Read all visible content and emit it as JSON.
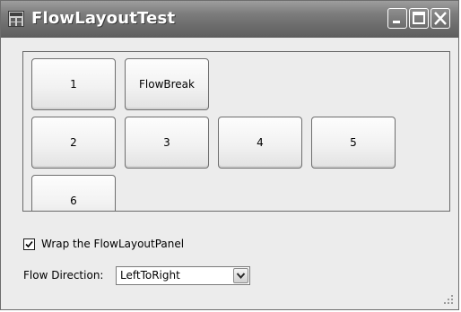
{
  "window": {
    "title": "FlowLayoutTest",
    "controls": [
      "minimize-icon",
      "maximize-icon",
      "close-icon"
    ]
  },
  "flow_panel": {
    "buttons": [
      {
        "id": "b1",
        "label": "1"
      },
      {
        "id": "bfb",
        "label": "FlowBreak"
      },
      {
        "id": "b2",
        "label": "2"
      },
      {
        "id": "b3",
        "label": "3"
      },
      {
        "id": "b4",
        "label": "4"
      },
      {
        "id": "b5",
        "label": "5"
      },
      {
        "id": "b6",
        "label": "6"
      }
    ]
  },
  "options": {
    "wrap_label": "Wrap the FlowLayoutPanel",
    "wrap_checked": true,
    "flow_direction_label": "Flow Direction:",
    "flow_direction_value": "LeftToRight"
  },
  "icons": {
    "app": "app-icon",
    "check": "checkmark-icon",
    "dropdown": "chevron-down-icon",
    "resize": "resize-grip-icon"
  },
  "colors": {
    "titlebar": "#7d7d7d",
    "client_bg": "#ececec",
    "button_border": "#6e6e6e"
  }
}
